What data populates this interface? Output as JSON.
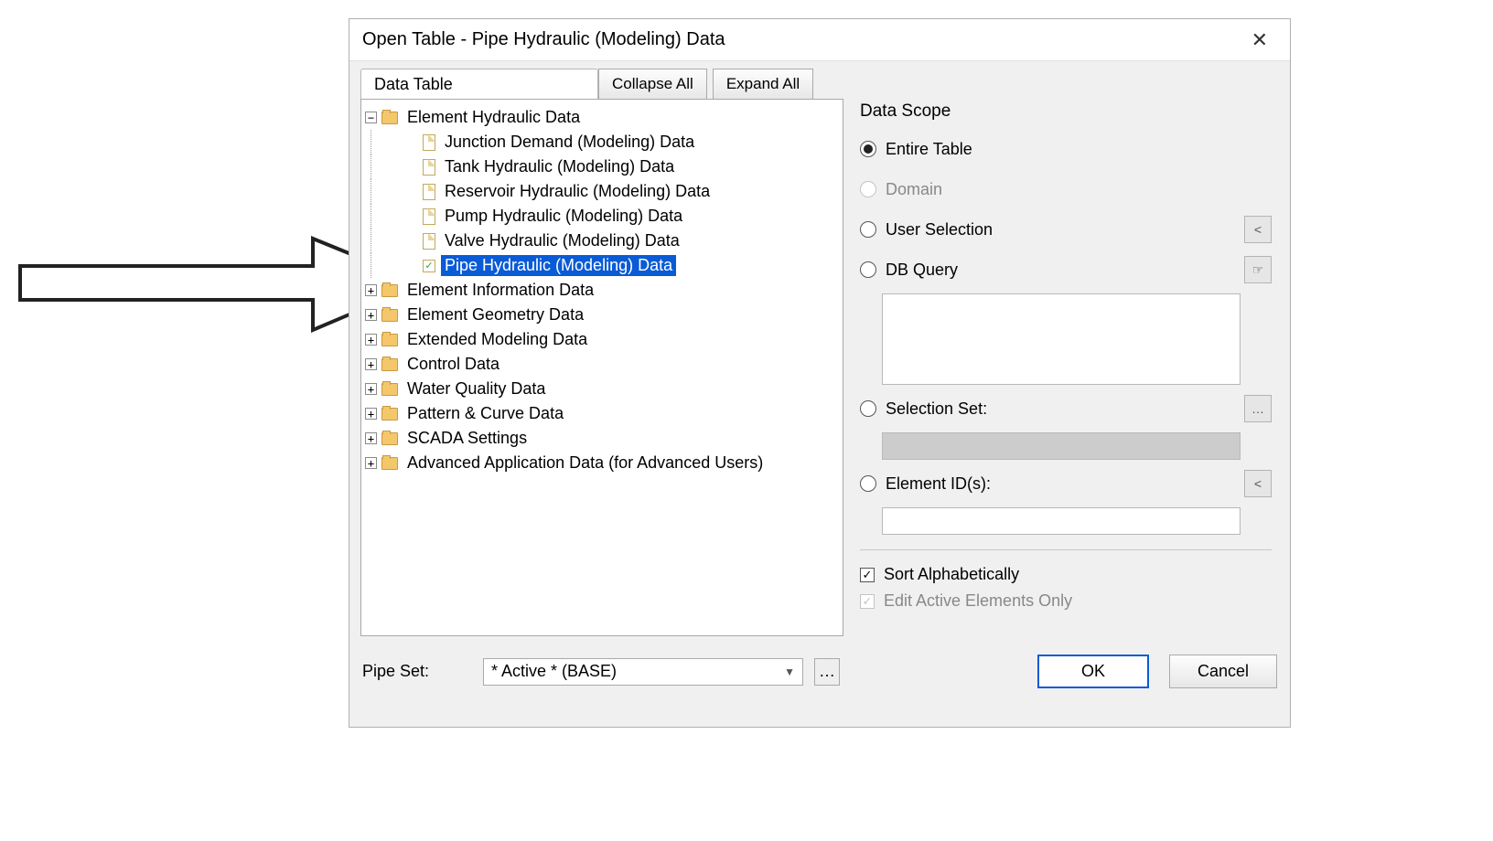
{
  "dialog": {
    "title": "Open Table - Pipe Hydraulic (Modeling) Data",
    "data_table_label": "Data Table",
    "collapse_all": "Collapse All",
    "expand_all": "Expand All"
  },
  "tree": {
    "root": "Element Hydraulic Data",
    "children": [
      "Junction Demand (Modeling) Data",
      "Tank Hydraulic (Modeling) Data",
      "Reservoir Hydraulic (Modeling) Data",
      "Pump Hydraulic (Modeling) Data",
      "Valve Hydraulic (Modeling) Data",
      "Pipe Hydraulic (Modeling) Data"
    ],
    "siblings": [
      "Element Information Data",
      "Element Geometry Data",
      "Extended Modeling Data",
      "Control Data",
      "Water Quality Data",
      "Pattern & Curve Data",
      "SCADA Settings",
      "Advanced Application Data (for Advanced Users)"
    ]
  },
  "scope": {
    "title": "Data Scope",
    "entire_table": "Entire Table",
    "domain": "Domain",
    "user_selection": "User Selection",
    "db_query": "DB Query",
    "selection_set": "Selection Set:",
    "element_ids": "Element ID(s):",
    "sort_alpha": "Sort Alphabetically",
    "edit_active": "Edit Active Elements Only"
  },
  "footer": {
    "pipe_set_label": "Pipe Set:",
    "pipe_set_value": "* Active * (BASE)",
    "ok": "OK",
    "cancel": "Cancel"
  }
}
